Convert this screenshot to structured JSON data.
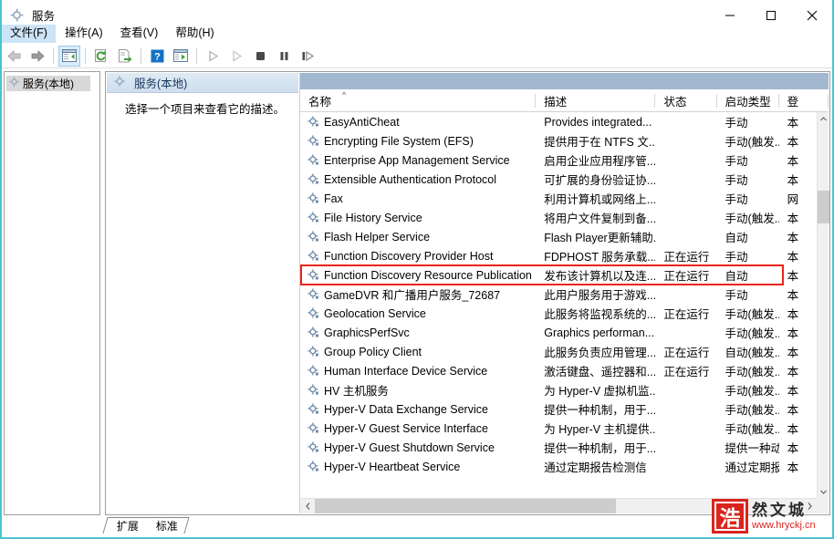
{
  "window": {
    "title": "服务",
    "icon": "services-gear-icon",
    "minimize_label": "最小化",
    "maximize_label": "最大化",
    "close_label": "关闭",
    "accent_border": "#4ec3cc"
  },
  "menubar": {
    "items": [
      {
        "label": "文件(F)",
        "mnemonic": "F",
        "active": true,
        "name": "menu-file"
      },
      {
        "label": "操作(A)",
        "mnemonic": "A",
        "active": false,
        "name": "menu-action"
      },
      {
        "label": "查看(V)",
        "mnemonic": "V",
        "active": false,
        "name": "menu-view"
      },
      {
        "label": "帮助(H)",
        "mnemonic": "H",
        "active": false,
        "name": "menu-help"
      }
    ]
  },
  "toolbar": {
    "buttons": [
      {
        "name": "back-button",
        "icon": "arrow-left-icon",
        "enabled": false
      },
      {
        "name": "forward-button",
        "icon": "arrow-right-icon",
        "enabled": true
      },
      {
        "name": "show-hide-tree-button",
        "icon": "show-console-tree-icon",
        "selected": true
      },
      {
        "name": "refresh-button",
        "icon": "refresh-icon",
        "enabled": true
      },
      {
        "name": "export-list-button",
        "icon": "export-list-icon",
        "enabled": true
      },
      {
        "name": "help-button",
        "icon": "question-mark-icon",
        "enabled": true
      },
      {
        "name": "properties-button",
        "icon": "properties-window-icon",
        "enabled": true
      },
      {
        "name": "start-service-button",
        "icon": "play-icon",
        "enabled": false
      },
      {
        "name": "resume-service-button",
        "icon": "play-outline-icon",
        "enabled": false
      },
      {
        "name": "stop-service-button",
        "icon": "stop-square-icon",
        "enabled": true
      },
      {
        "name": "pause-service-button",
        "icon": "pause-icon",
        "enabled": true
      },
      {
        "name": "restart-service-button",
        "icon": "restart-icon",
        "enabled": true
      }
    ]
  },
  "tree": {
    "node_label": "服务(本地)",
    "node_icon": "services-gear-icon"
  },
  "detail_pane": {
    "header": "服务(本地)",
    "header_icon": "services-gear-icon",
    "description": "选择一个项目来查看它的描述。"
  },
  "list": {
    "columns": [
      {
        "key": "name",
        "label": "名称",
        "sorted": true,
        "sort_glyph": "^"
      },
      {
        "key": "description",
        "label": "描述"
      },
      {
        "key": "status",
        "label": "状态"
      },
      {
        "key": "startup",
        "label": "启动类型"
      },
      {
        "key": "logon",
        "label": "登"
      }
    ],
    "rows": [
      {
        "name": "EasyAntiCheat",
        "description": "Provides integrated...",
        "status": "",
        "startup": "手动",
        "logon": "本"
      },
      {
        "name": "Encrypting File System (EFS)",
        "description": "提供用于在 NTFS 文...",
        "status": "",
        "startup": "手动(触发...",
        "logon": "本"
      },
      {
        "name": "Enterprise App Management Service",
        "description": "启用企业应用程序管...",
        "status": "",
        "startup": "手动",
        "logon": "本"
      },
      {
        "name": "Extensible Authentication Protocol",
        "description": "可扩展的身份验证协...",
        "status": "",
        "startup": "手动",
        "logon": "本"
      },
      {
        "name": "Fax",
        "description": "利用计算机或网络上...",
        "status": "",
        "startup": "手动",
        "logon": "网"
      },
      {
        "name": "File History Service",
        "description": "将用户文件复制到备...",
        "status": "",
        "startup": "手动(触发...",
        "logon": "本"
      },
      {
        "name": "Flash Helper Service",
        "description": "Flash Player更新辅助...",
        "status": "",
        "startup": "自动",
        "logon": "本"
      },
      {
        "name": "Function Discovery Provider Host",
        "description": "FDPHOST 服务承载...",
        "status": "正在运行",
        "startup": "手动",
        "logon": "本"
      },
      {
        "name": "Function Discovery Resource Publication",
        "description": "发布该计算机以及连...",
        "status": "正在运行",
        "startup": "自动",
        "logon": "本",
        "highlighted": true
      },
      {
        "name": "GameDVR 和广播用户服务_72687",
        "description": "此用户服务用于游戏...",
        "status": "",
        "startup": "手动",
        "logon": "本"
      },
      {
        "name": "Geolocation Service",
        "description": "此服务将监视系统的...",
        "status": "正在运行",
        "startup": "手动(触发...",
        "logon": "本"
      },
      {
        "name": "GraphicsPerfSvc",
        "description": "Graphics performan...",
        "status": "",
        "startup": "手动(触发...",
        "logon": "本"
      },
      {
        "name": "Group Policy Client",
        "description": "此服务负责应用管理...",
        "status": "正在运行",
        "startup": "自动(触发...",
        "logon": "本"
      },
      {
        "name": "Human Interface Device Service",
        "description": "激活键盘、遥控器和...",
        "status": "正在运行",
        "startup": "手动(触发...",
        "logon": "本"
      },
      {
        "name": "HV 主机服务",
        "description": "为 Hyper-V 虚拟机监...",
        "status": "",
        "startup": "手动(触发...",
        "logon": "本"
      },
      {
        "name": "Hyper-V Data Exchange Service",
        "description": "提供一种机制，用于...",
        "status": "",
        "startup": "手动(触发...",
        "logon": "本"
      },
      {
        "name": "Hyper-V Guest Service Interface",
        "description": "为 Hyper-V 主机提供...",
        "status": "",
        "startup": "手动(触发...",
        "logon": "本"
      },
      {
        "name": "Hyper-V Guest Shutdown Service",
        "description": "提供一种机制，用于...",
        "status": "",
        "startup": "提供一种动(触发...",
        "logon": "本"
      },
      {
        "name": "Hyper-V Heartbeat Service",
        "description": "通过定期报告检测信",
        "status": "",
        "startup": "通过定期报告检发...",
        "logon": "本"
      }
    ],
    "row_icon": "service-gear-icon",
    "highlight_color": "#e8241b",
    "scroll": {
      "vertical_up_glyph": "^",
      "vertical_down_glyph": "v",
      "horizontal_left_glyph": "<",
      "horizontal_right_glyph": ">"
    }
  },
  "tabs": [
    {
      "label": "扩展",
      "name": "tab-extended",
      "active": false
    },
    {
      "label": "标准",
      "name": "tab-standard",
      "active": true
    }
  ],
  "watermark": {
    "seal_char": "浩",
    "name": "然文城",
    "url": "www.hryckj.cn",
    "seal_color": "#d9251d"
  }
}
